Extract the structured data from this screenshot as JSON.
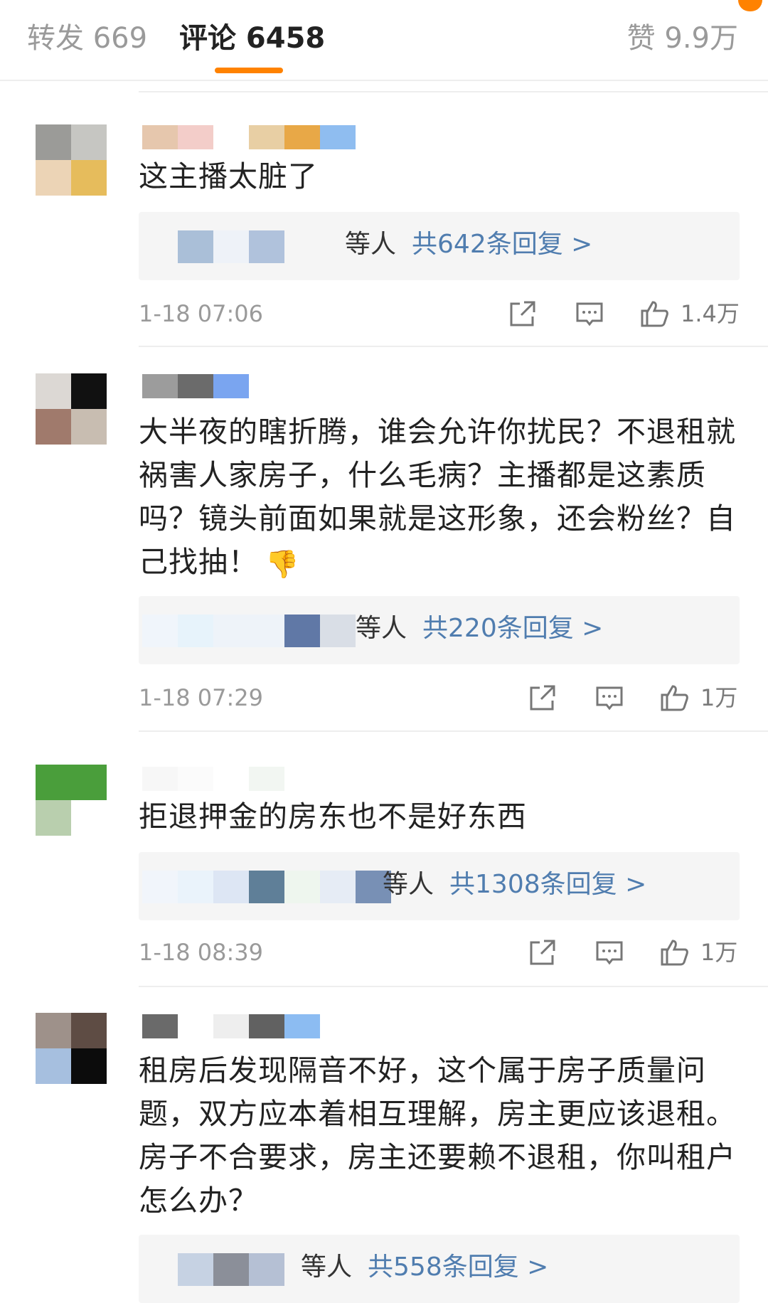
{
  "tabs": {
    "repost": "转发 669",
    "comment": "评论 6458",
    "like": "赞 9.9万"
  },
  "colors": {
    "accent": "#ff8200",
    "link": "#507daf",
    "meta_text": "#9a9a9a"
  },
  "icons": {
    "share": "share-icon",
    "reply": "comment-bubble-icon",
    "like": "thumbs-up-icon"
  },
  "comments": [
    {
      "text": "这主播太脏了",
      "reply_who": "等人",
      "reply_count": "共642条回复 >",
      "time": "1-18 07:06",
      "likes": "1.4万"
    },
    {
      "text": "大半夜的瞎折腾，谁会允许你扰民？不退租就祸害人家房子，什么毛病？主播都是这素质吗？镜头前面如果就是这形象，还会粉丝？自己找抽！",
      "emoji": "👎",
      "reply_who": "等人",
      "reply_count": "共220条回复 >",
      "time": "1-18 07:29",
      "likes": "1万"
    },
    {
      "text": "拒退押金的房东也不是好东西",
      "reply_who": "等人",
      "reply_count": "共1308条回复 >",
      "time": "1-18 08:39",
      "likes": "1万"
    },
    {
      "text": "租房后发现隔音不好，这个属于房子质量问题，双方应本着相互理解，房主更应该退租。房子不合要求，房主还要赖不退租，你叫租户怎么办？",
      "reply_who": "等人",
      "reply_count": "共558条回复 >"
    }
  ]
}
